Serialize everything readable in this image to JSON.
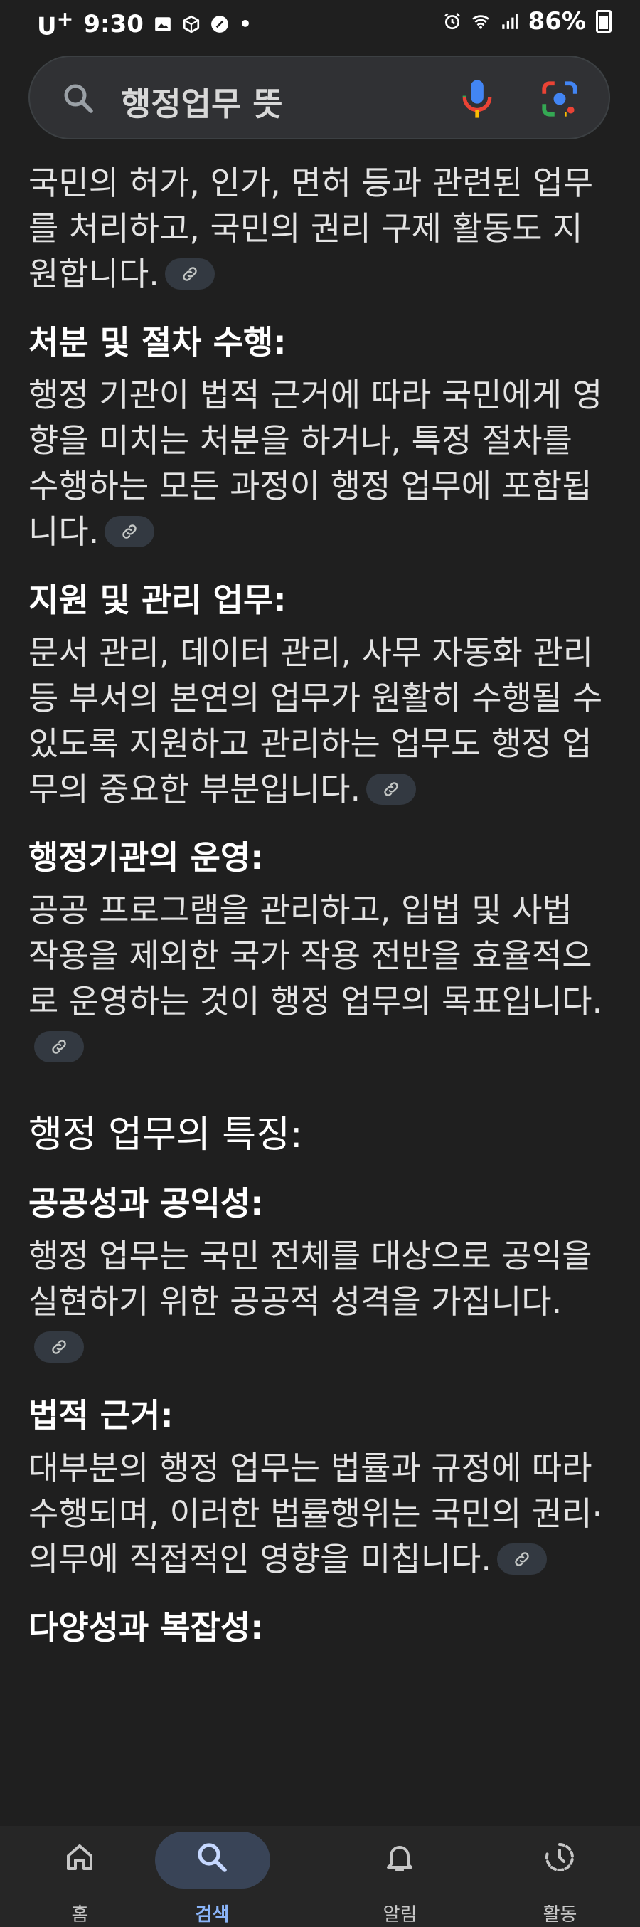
{
  "status_bar": {
    "carrier": "U",
    "carrier_sup": "+",
    "time": "9:30",
    "battery": "86%",
    "icons": [
      "gallery-icon",
      "cube-icon",
      "feather-icon",
      "dot-icon",
      "alarm-icon",
      "wifi-icon",
      "signal-icon",
      "battery-icon"
    ]
  },
  "search": {
    "query": "행정업무 뜻",
    "icons": [
      "search-icon",
      "mic-icon",
      "lens-icon"
    ]
  },
  "content": {
    "p1": "국민의 허가, 인가, 면허 등과 관련된 업무를 처리하고, 국민의 권리 구제 활동도 지원합니다.",
    "h2": "처분 및 절차 수행:",
    "p2": "행정 기관이 법적 근거에 따라 국민에게 영향을 미치는 처분을 하거나, 특정 절차를 수행하는 모든 과정이 행정 업무에 포함됩니다.",
    "h3": "지원 및 관리 업무:",
    "p3": "문서 관리, 데이터 관리, 사무 자동화 관리 등 부서의 본연의 업무가 원활히 수행될 수 있도록 지원하고 관리하는 업무도 행정 업무의 중요한 부분입니다.",
    "h4": "행정기관의 운영:",
    "p4": "공공 프로그램을 관리하고, 입법 및 사법 작용을 제외한 국가 작용 전반을 효율적으로 운영하는 것이 행정 업무의 목표입니다.",
    "section_title": "행정 업무의 특징:",
    "h5": "공공성과 공익성:",
    "p5": "행정 업무는 국민 전체를 대상으로 공익을 실현하기 위한 공공적 성격을 가집니다.",
    "h6": "법적 근거:",
    "p6": "대부분의 행정 업무는 법률과 규정에 따라 수행되며, 이러한 법률행위는 국민의 권리·의무에 직접적인 영향을 미칩니다.",
    "h7": "다양성과 복잡성:"
  },
  "bottom_nav": {
    "items": [
      {
        "label": "홈",
        "icon": "home-icon"
      },
      {
        "label": "검색",
        "icon": "search-icon",
        "active": true
      },
      {
        "label": "알림",
        "icon": "bell-icon"
      },
      {
        "label": "활동",
        "icon": "activity-icon"
      }
    ]
  }
}
